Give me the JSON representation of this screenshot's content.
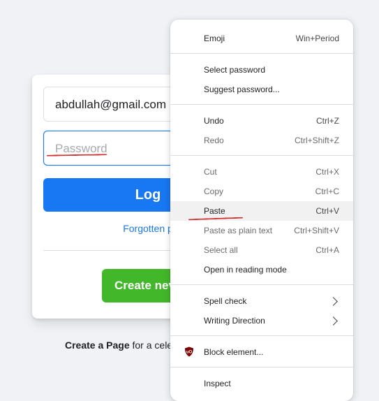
{
  "login": {
    "email_value": "abdullah@gmail.com",
    "password_placeholder": "Password",
    "login_label": "Log",
    "forgot_label": "Forgotten p",
    "create_label": "Create nev",
    "create_page_bold": "Create a Page",
    "create_page_rest": " for a cele"
  },
  "menu": {
    "emoji": {
      "label": "Emoji",
      "shortcut": "Win+Period"
    },
    "select_password": {
      "label": "Select password"
    },
    "suggest_password": {
      "label": "Suggest password..."
    },
    "undo": {
      "label": "Undo",
      "shortcut": "Ctrl+Z"
    },
    "redo": {
      "label": "Redo",
      "shortcut": "Ctrl+Shift+Z"
    },
    "cut": {
      "label": "Cut",
      "shortcut": "Ctrl+X"
    },
    "copy": {
      "label": "Copy",
      "shortcut": "Ctrl+C"
    },
    "paste": {
      "label": "Paste",
      "shortcut": "Ctrl+V"
    },
    "paste_plain": {
      "label": "Paste as plain text",
      "shortcut": "Ctrl+Shift+V"
    },
    "select_all": {
      "label": "Select all",
      "shortcut": "Ctrl+A"
    },
    "reading_mode": {
      "label": "Open in reading mode"
    },
    "spell_check": {
      "label": "Spell check"
    },
    "writing_direction": {
      "label": "Writing Direction"
    },
    "block_element": {
      "label": "Block element...",
      "icon": "ublock-origin-icon"
    },
    "inspect": {
      "label": "Inspect"
    }
  },
  "colors": {
    "primary_blue": "#1877f2",
    "create_green": "#42b72a",
    "annotation_red": "#d32f2f"
  }
}
